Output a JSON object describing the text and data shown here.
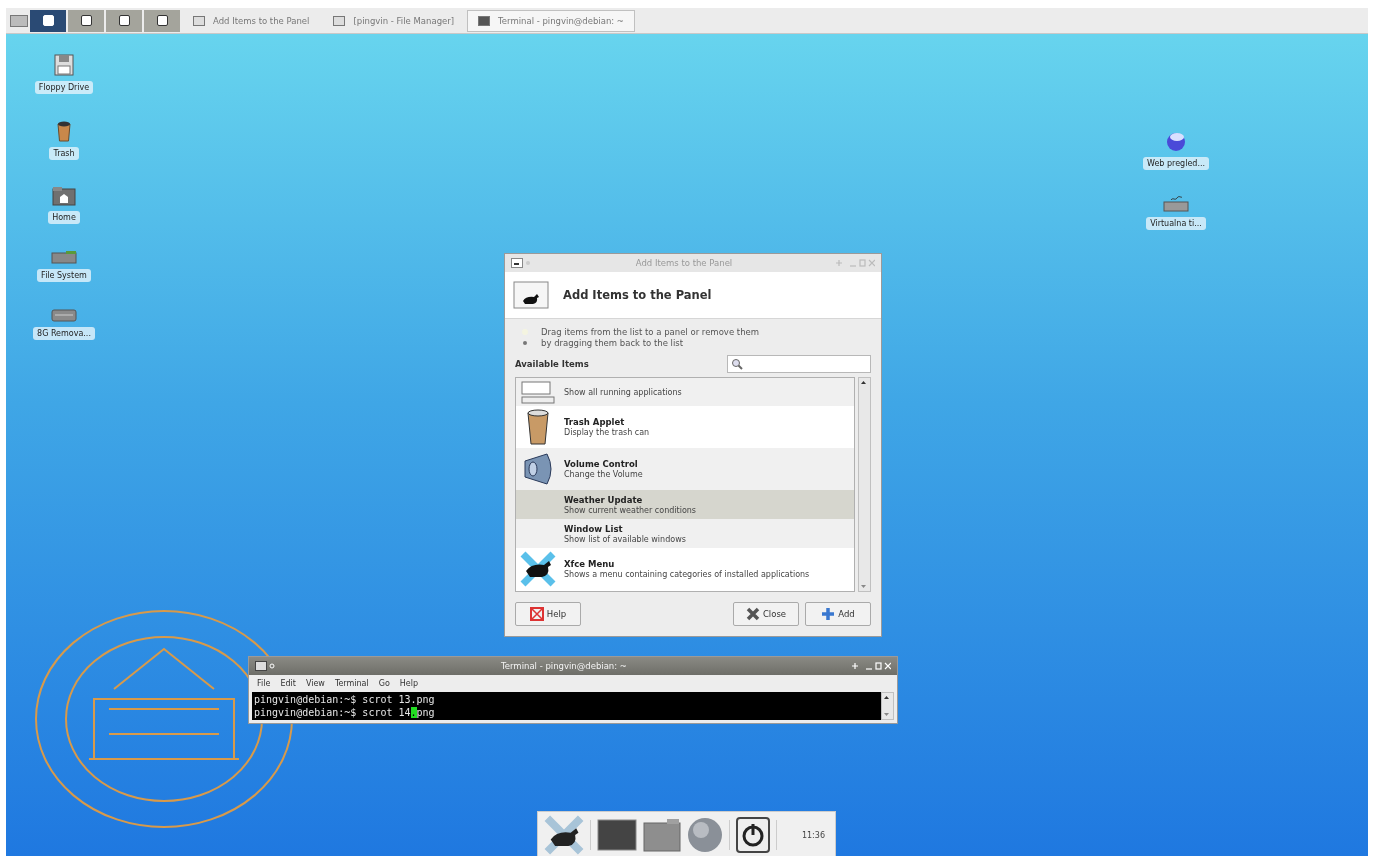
{
  "top_panel": {
    "workspaces": [
      {
        "selected": true
      },
      {
        "selected": false
      },
      {
        "selected": false
      },
      {
        "selected": false
      }
    ],
    "tasks": [
      {
        "label": "Add Items to the Panel",
        "kind": "dialog",
        "selected": false
      },
      {
        "label": "[pingvin - File Manager]",
        "kind": "folder",
        "selected": false
      },
      {
        "label": "Terminal - pingvin@debian: ~",
        "kind": "terminal",
        "selected": true
      }
    ]
  },
  "desktop_left_icons": [
    {
      "label": "Floppy Drive",
      "kind": "floppy"
    },
    {
      "label": "Trash",
      "kind": "trash"
    },
    {
      "label": "Home",
      "kind": "home"
    },
    {
      "label": "File System",
      "kind": "drive"
    },
    {
      "label": "8G Remova...",
      "kind": "removable"
    }
  ],
  "desktop_right_icons": [
    {
      "label": "Web pregled...",
      "kind": "globe"
    },
    {
      "label": "Virtualna  ti...",
      "kind": "keyboard"
    }
  ],
  "dialog": {
    "title": "Add Items to the Panel",
    "header": "Add Items to the Panel",
    "hint": "Drag items from the list to a panel or remove them by dragging them back to the list",
    "section_label": "Available Items",
    "items": [
      {
        "description": "Show all running applications",
        "kind": "tasklist",
        "selected": false
      },
      {
        "title": "Trash Applet",
        "description": "Display the trash can",
        "kind": "trash",
        "selected": false
      },
      {
        "title": "Volume Control",
        "description": "Change the Volume",
        "kind": "volume",
        "selected": false
      },
      {
        "title": "Weather Update",
        "description": "Show current weather conditions",
        "kind": "none",
        "selected": true
      },
      {
        "title": "Window List",
        "description": "Show list of available windows",
        "kind": "none",
        "selected": false
      },
      {
        "title": "Xfce Menu",
        "description": "Shows a menu containing categories of installed applications",
        "kind": "xfce",
        "selected": false
      }
    ],
    "buttons": [
      {
        "label": "Help",
        "kind": "help"
      },
      {
        "label": "Close",
        "kind": "close"
      },
      {
        "label": "Add",
        "kind": "add"
      }
    ]
  },
  "terminal": {
    "title": "Terminal - pingvin@debian: ~",
    "menu": [
      "File",
      "Edit",
      "View",
      "Terminal",
      "Go",
      "Help"
    ],
    "lines": [
      {
        "text": "pingvin@debian:~$ scrot 13.png"
      },
      {
        "text": "pingvin@debian:~$ scrot 14",
        "cursor": ".",
        "after": "png"
      }
    ]
  },
  "dock": {
    "items": [
      {
        "kind": "xfce"
      },
      {
        "kind": "terminal"
      },
      {
        "kind": "folder"
      },
      {
        "kind": "globe"
      },
      {
        "kind": "power"
      }
    ],
    "clock": "11:36"
  }
}
